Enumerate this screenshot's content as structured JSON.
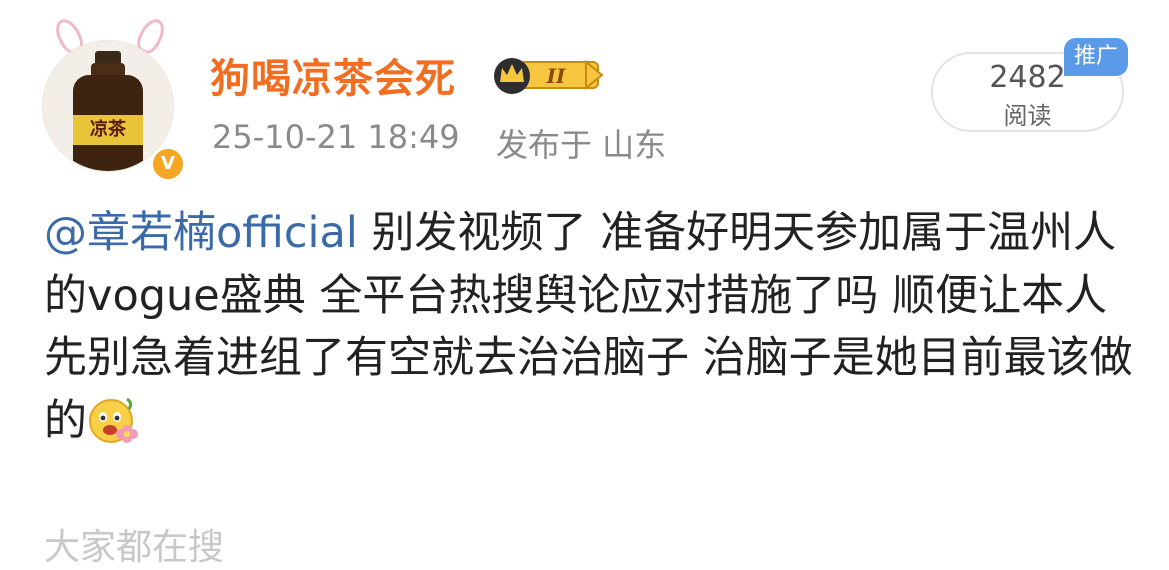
{
  "post": {
    "author": {
      "name": "狗喝凉茶会死",
      "avatar_label": "凉茶",
      "verified_mark": "V",
      "vip_level": "II"
    },
    "timestamp": "25-10-21 18:49",
    "location": "发布于 山东",
    "reads": {
      "count": "2482",
      "label": "阅读"
    },
    "promo_tag": "推广",
    "content": {
      "mention": "@章若楠official",
      "text": " 别发视频了 准备好明天参加属于温州人的vogue盛典 全平台热搜舆论应对措施了吗 顺便让本人先别急着进组了有空就去治治脑子 治脑子是她目前最该做的",
      "emoji": "happy-flower-emoji"
    },
    "footer_hint": "大家都在搜"
  },
  "colors": {
    "username": "#f36d21",
    "mention": "#3b6aa8",
    "meta": "#8a8a8a",
    "promo": "#5a9ae8",
    "verified": "#f5a623"
  }
}
